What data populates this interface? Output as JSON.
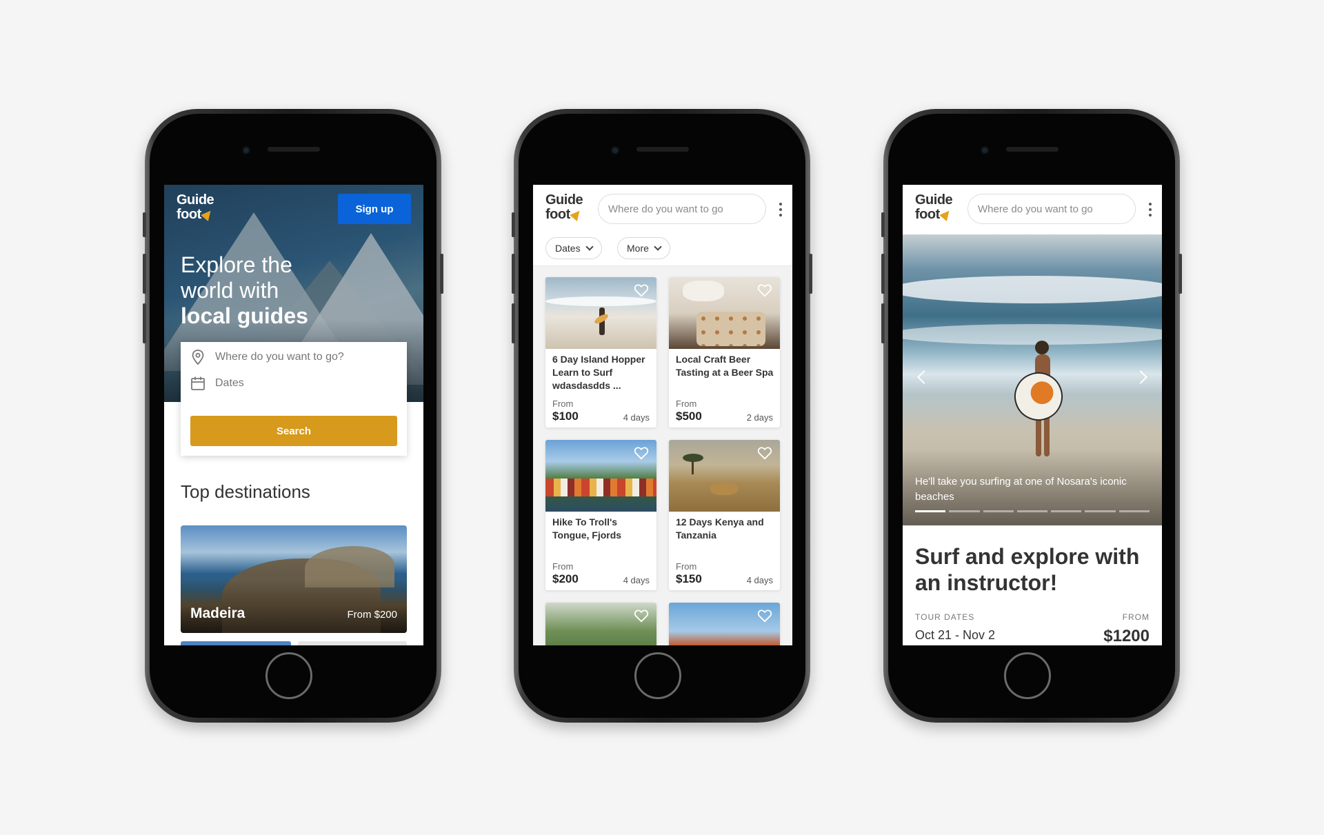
{
  "brand": {
    "line1": "Guide",
    "line2": "foot",
    "accent": "#e5a21d"
  },
  "colors": {
    "primary_blue": "#0a63d8",
    "search_yellow": "#d79a1c"
  },
  "screen1": {
    "signup_label": "Sign up",
    "hero": {
      "line1": "Explore the",
      "line2": "world with",
      "line3": "local guides"
    },
    "search": {
      "destination_placeholder": "Where do you want to go?",
      "dates_placeholder": "Dates",
      "button_label": "Search",
      "destination_icon": "location-pin-icon",
      "dates_icon": "calendar-icon"
    },
    "top_destinations_heading": "Top destinations",
    "destination": {
      "name": "Madeira",
      "price": "From $200"
    }
  },
  "screen2": {
    "search_placeholder": "Where do you want to go",
    "filters": [
      {
        "label": "Dates"
      },
      {
        "label": "More"
      }
    ],
    "tours": [
      {
        "title": "6 Day Island Hopper Learn to Surf wdasdasdds ...",
        "from": "From",
        "price": "$100",
        "days": "4 days"
      },
      {
        "title": "Local Craft Beer Tasting at a Beer Spa",
        "from": "From",
        "price": "$500",
        "days": "2 days"
      },
      {
        "title": "Hike To Troll's Tongue, Fjords",
        "from": "From",
        "price": "$200",
        "days": "4 days"
      },
      {
        "title": "12 Days Kenya and Tanzania",
        "from": "From",
        "price": "$150",
        "days": "4 days"
      }
    ]
  },
  "screen3": {
    "search_placeholder": "Where do you want to go",
    "caption": "He'll take you surfing at one of Nosara's iconic beaches",
    "slides_total": 7,
    "slide_active": 1,
    "title": "Surf and explore with an instructor!",
    "tour_dates_label": "TOUR DATES",
    "tour_dates": "Oct 21 - Nov 2",
    "from_label": "FROM",
    "price": "$1200"
  }
}
